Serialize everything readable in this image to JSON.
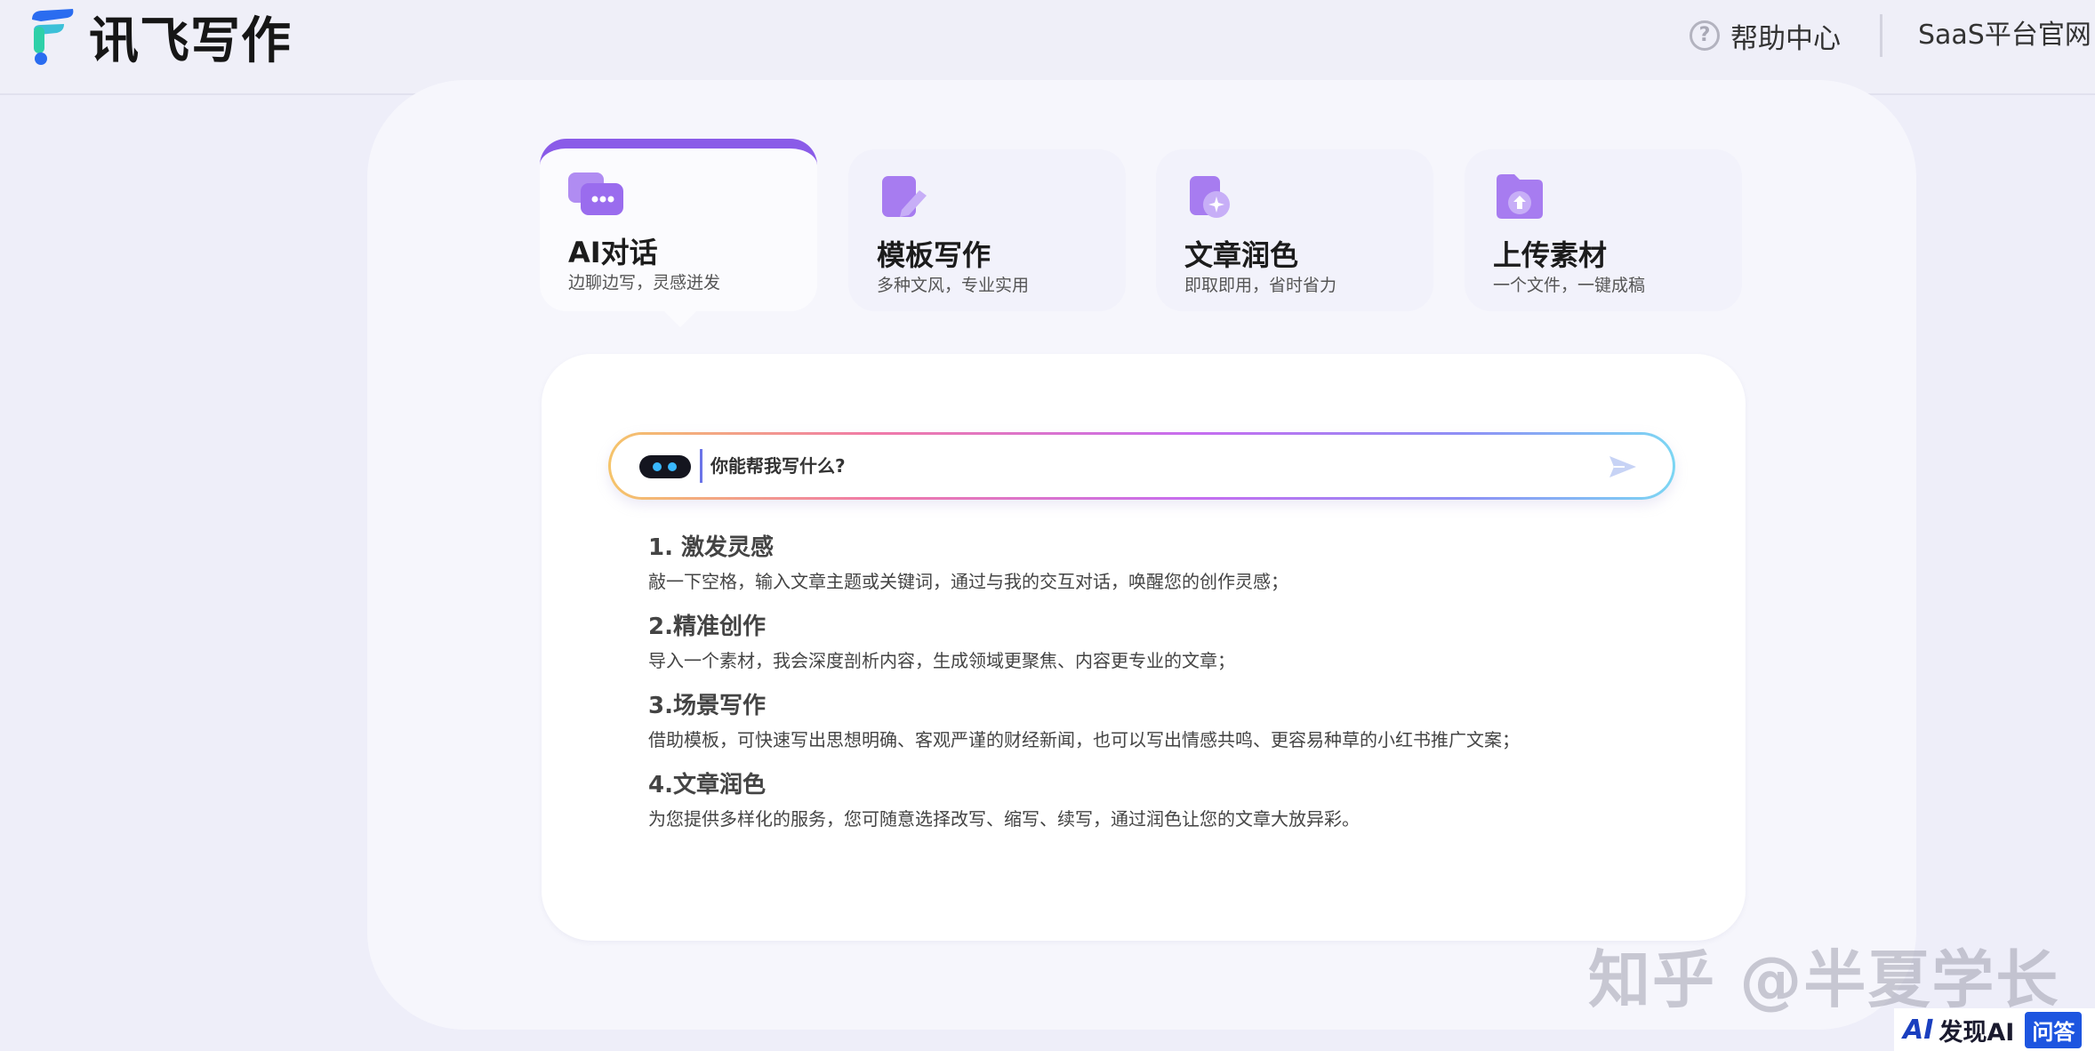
{
  "header": {
    "app_title": "讯飞写作",
    "help_label": "帮助中心",
    "saas_label": "SaaS平台官网"
  },
  "cards": [
    {
      "title": "AI对话",
      "subtitle": "边聊边写，灵感迸发",
      "icon": "chat-bubble-icon",
      "active": true
    },
    {
      "title": "模板写作",
      "subtitle": "多种文风，专业实用",
      "icon": "template-doc-icon",
      "active": false
    },
    {
      "title": "文章润色",
      "subtitle": "即取即用，省时省力",
      "icon": "polish-doc-icon",
      "active": false
    },
    {
      "title": "上传素材",
      "subtitle": "一个文件，一键成稿",
      "icon": "upload-folder-icon",
      "active": false
    }
  ],
  "input": {
    "placeholder": "你能帮我写什么?"
  },
  "tips": [
    {
      "title": "1. 激发灵感",
      "desc": "敲一下空格，输入文章主题或关键词，通过与我的交互对话，唤醒您的创作灵感；"
    },
    {
      "title": "2.精准创作",
      "desc": "导入一个素材，我会深度剖析内容，生成领域更聚焦、内容更专业的文章；"
    },
    {
      "title": "3.场景写作",
      "desc": "借助模板，可快速写出思想明确、客观严谨的财经新闻，也可以写出情感共鸣、更容易种草的小红书推广文案；"
    },
    {
      "title": "4.文章润色",
      "desc": "为您提供多样化的服务，您可随意选择改写、缩写、续写，通过润色让您的文章大放异彩。"
    }
  ],
  "watermark": {
    "zhihu": "知乎 @半夏学长",
    "ai_mark": "AI",
    "site": "发现AI",
    "qa": "问答"
  },
  "colors": {
    "accent": "#8a5be8",
    "background": "#eeeef9",
    "card_icon": "#a77cf0"
  }
}
